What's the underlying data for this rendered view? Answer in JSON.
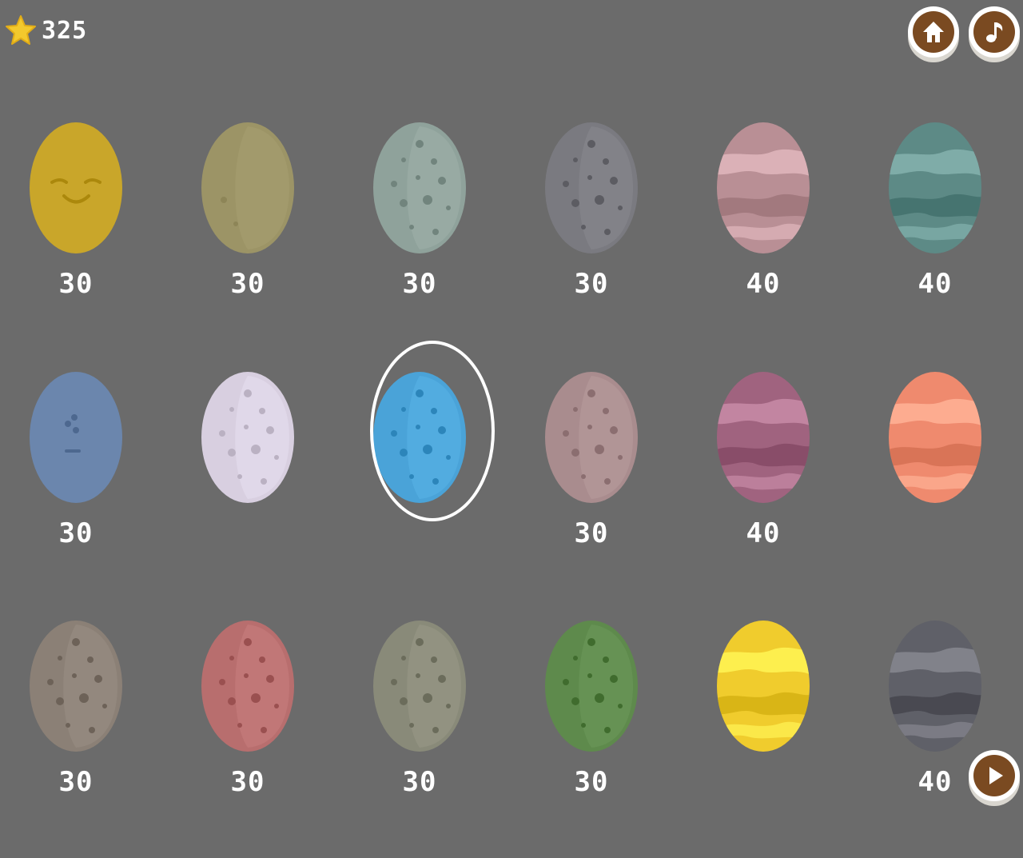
{
  "header": {
    "score": "325",
    "score_icon": "star-icon",
    "home_icon": "home-icon",
    "music_icon": "music-note-icon"
  },
  "footer": {
    "play_icon": "play-icon"
  },
  "eggs": [
    {
      "id": "r1c1",
      "price": "30",
      "style": "face-smile",
      "color": "#c9a62a"
    },
    {
      "id": "r1c2",
      "price": "30",
      "style": "plain",
      "color": "#9c9466"
    },
    {
      "id": "r1c3",
      "price": "30",
      "style": "spots",
      "color": "#8fa29b"
    },
    {
      "id": "r1c4",
      "price": "30",
      "style": "crater",
      "color": "#7a7a80"
    },
    {
      "id": "r1c5",
      "price": "40",
      "style": "stripes",
      "color": "#b98f95"
    },
    {
      "id": "r1c6",
      "price": "40",
      "style": "stripes",
      "color": "#5d8a86"
    },
    {
      "id": "r2c1",
      "price": "30",
      "style": "face-sleepy",
      "color": "#6b86ad"
    },
    {
      "id": "r2c2",
      "price": "",
      "style": "spots",
      "color": "#d8cfe0"
    },
    {
      "id": "r2c3",
      "price": "",
      "style": "spots",
      "color": "#4aa3d8",
      "selected": true
    },
    {
      "id": "r2c4",
      "price": "30",
      "style": "spots",
      "color": "#a98c8e"
    },
    {
      "id": "r2c5",
      "price": "40",
      "style": "stripes",
      "color": "#a0637f"
    },
    {
      "id": "r2c6",
      "price": "",
      "style": "stripes",
      "color": "#ef8a6e"
    },
    {
      "id": "r3c1",
      "price": "30",
      "style": "spots",
      "color": "#8b8076"
    },
    {
      "id": "r3c2",
      "price": "30",
      "style": "spots",
      "color": "#b86e6e"
    },
    {
      "id": "r3c3",
      "price": "30",
      "style": "spots",
      "color": "#898a79"
    },
    {
      "id": "r3c4",
      "price": "30",
      "style": "spots",
      "color": "#5e8a4c"
    },
    {
      "id": "r3c5",
      "price": "",
      "style": "stripes",
      "color": "#f0cc2d"
    },
    {
      "id": "r3c6",
      "price": "40",
      "style": "stripes",
      "color": "#5f6068"
    }
  ]
}
